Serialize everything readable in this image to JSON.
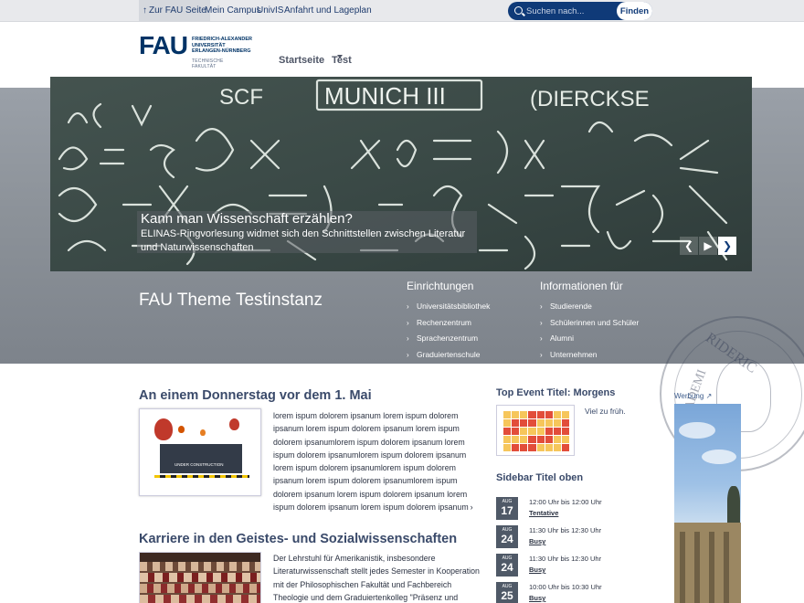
{
  "metabar": {
    "back_link": "Zur FAU Seite",
    "links": [
      "Mein Campus",
      "UnivIS",
      "Anfahrt und Lageplan"
    ],
    "search_placeholder": "Suchen nach...",
    "search_button": "Finden"
  },
  "logo": {
    "mark": "FAU",
    "text": "FRIEDRICH-ALEXANDER\nUNIVERSITÄT\nERLANGEN-NÜRNBERG",
    "sub": "TECHNISCHE FAKULTÄT"
  },
  "nav": {
    "items": [
      "Startseite",
      "Test"
    ]
  },
  "hero": {
    "title": "Kann man Wissenschaft erzählen?",
    "text": "ELINAS-Ringvorlesung widmet sich den Schnittstellen zwischen Literatur und Naturwissenschaften",
    "chalk_text": "MUNICH III",
    "chalk_text2": "SCF",
    "chalk_text3": "(DIERCKSE"
  },
  "site_title": "FAU Theme Testinstanz",
  "quicklinks": {
    "einrichtungen": {
      "title": "Einrichtungen",
      "items": [
        "Universitätsbibliothek",
        "Rechenzentrum",
        "Sprachenzentrum",
        "Graduiertenschule"
      ]
    },
    "informationen": {
      "title": "Informationen für",
      "items": [
        "Studierende",
        "Schülerinnen und Schüler",
        "Alumni",
        "Unternehmen"
      ]
    }
  },
  "posts": [
    {
      "title": "An einem Donnerstag vor dem 1. Mai",
      "thumb_text": "UNDER CONSTRUCTION",
      "text": "lorem ispum dolorem ipsanum lorem ispum dolorem ipsanum lorem ispum dolorem ipsanum lorem ispum dolorem ipsanumlorem ispum dolorem ipsanum lorem ispum dolorem ipsanumlorem ispum dolorem ipsanum lorem ispum dolorem ipsanumlorem ispum dolorem ipsanum lorem ispum dolorem ipsanumlorem ispum dolorem ipsanum lorem ispum dolorem ipsanum lorem ispum dolorem ipsanum lorem ispum dolorem ipsanum"
    },
    {
      "title": "Karriere in den Geistes- und Sozialwissenschaften",
      "text": "Der Lehrstuhl für Amerikanistik, insbesondere Literaturwissenschaft stellt jedes Semester in Kooperation mit der Philosophischen Fakultät und Fachbereich Theologie und dem Graduiertenkolleg \"Präsenz und Implizites"
    }
  ],
  "top_event": {
    "title": "Top Event Titel: Morgens",
    "note": "Viel zu früh."
  },
  "sidebar": {
    "title": "Sidebar Titel oben",
    "events": [
      {
        "month": "AUG",
        "day": "17",
        "time": "12:00 Uhr bis 12:00 Uhr",
        "status": "Tentative"
      },
      {
        "month": "AUG",
        "day": "24",
        "time": "11:30 Uhr bis 12:30 Uhr",
        "status": "Busy"
      },
      {
        "month": "AUG",
        "day": "24",
        "time": "11:30 Uhr bis 12:30 Uhr",
        "status": "Busy"
      },
      {
        "month": "AUG",
        "day": "25",
        "time": "10:00 Uhr bis 10:30 Uhr",
        "status": "Busy"
      }
    ]
  },
  "ad": {
    "label": "Werbung"
  }
}
